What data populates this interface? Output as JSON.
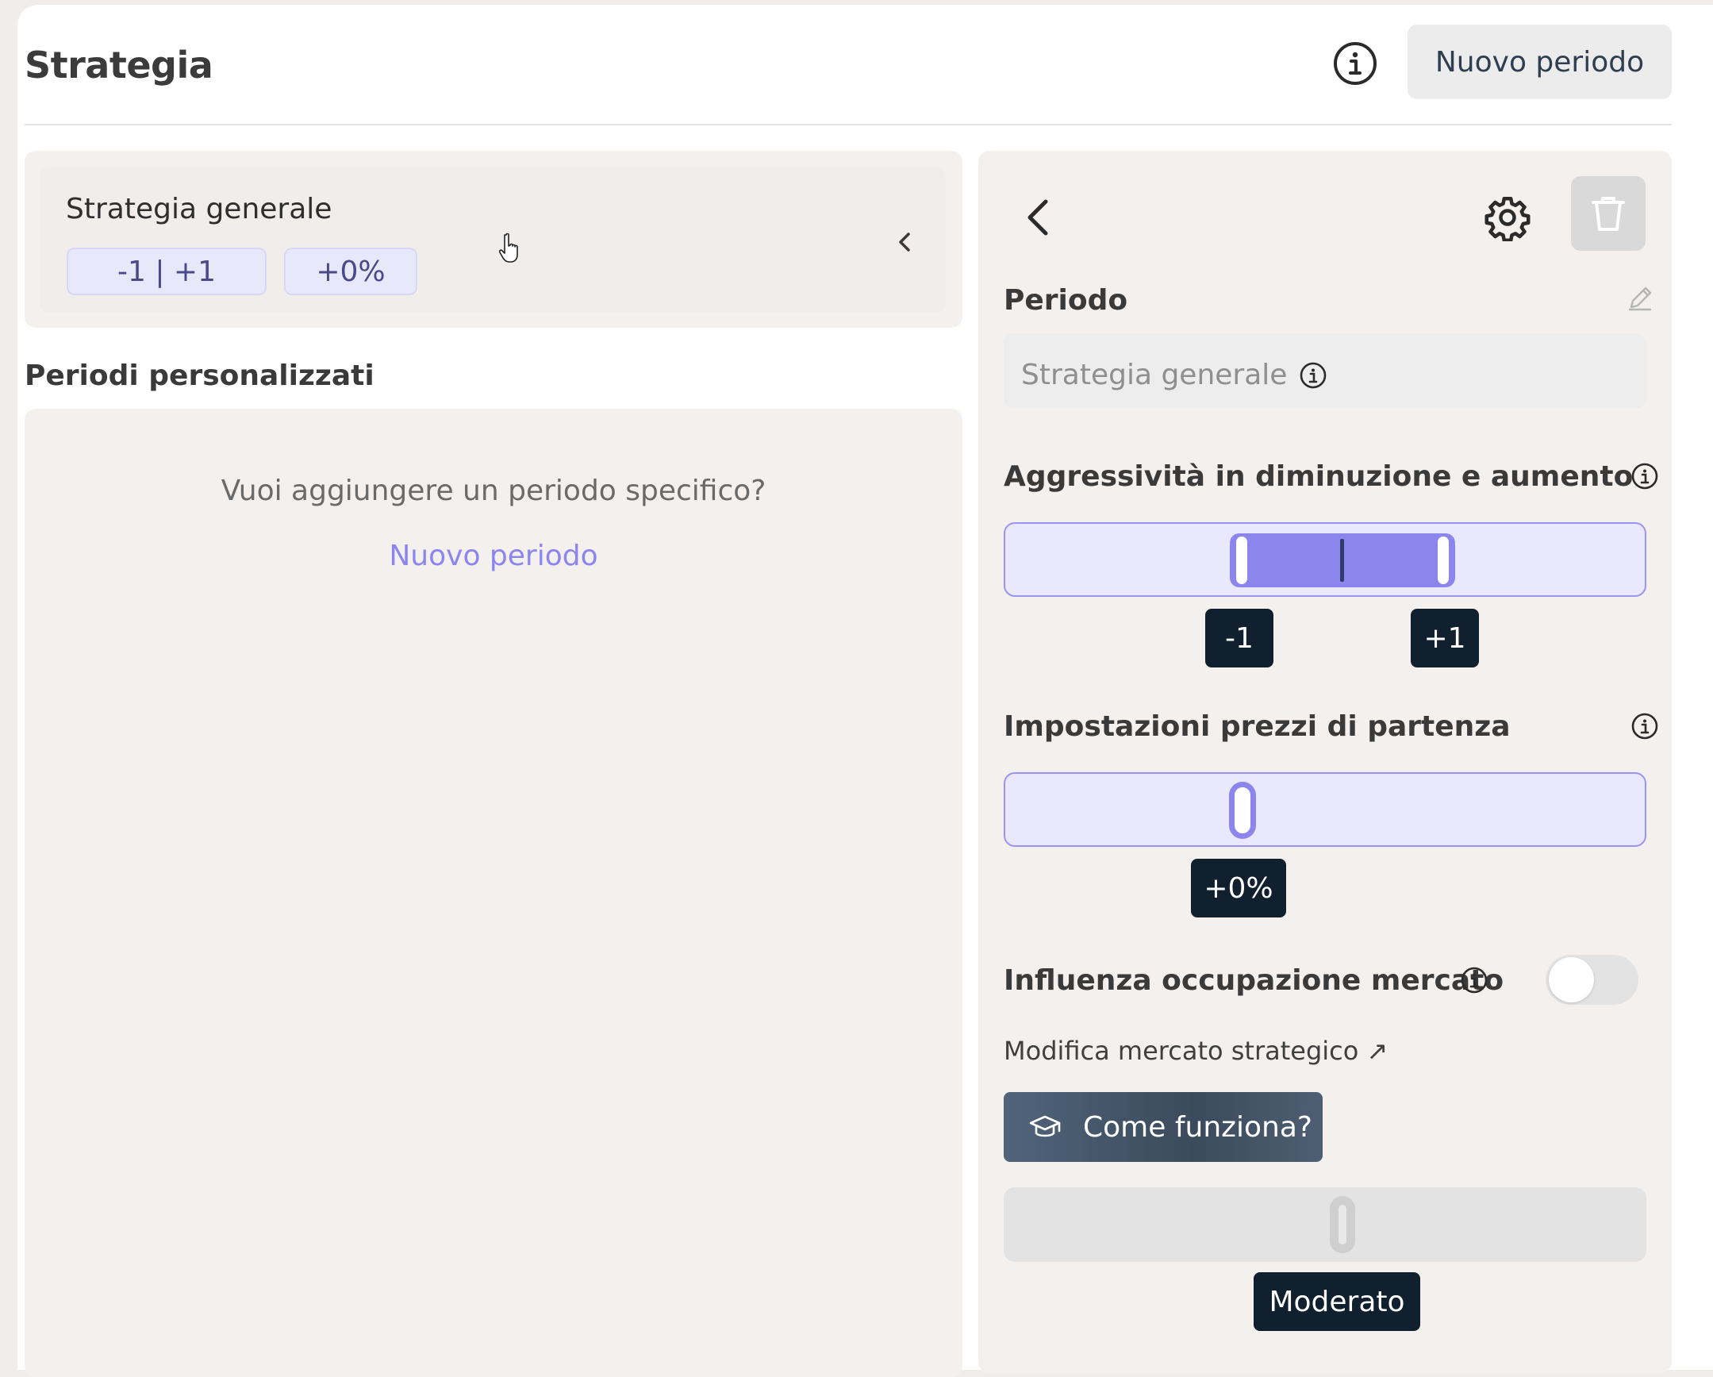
{
  "header": {
    "title": "Strategia",
    "new_period_button": "Nuovo periodo",
    "info_icon": "info-icon"
  },
  "general_strategy": {
    "title": "Strategia generale",
    "aggressiveness_chip": "-1 | +1",
    "price_chip": "+0%"
  },
  "custom_periods": {
    "title": "Periodi personalizzati",
    "empty_question": "Vuoi aggiungere un periodo specifico?",
    "add_link": "Nuovo periodo"
  },
  "detail": {
    "period_label": "Periodo",
    "period_value": "Strategia generale",
    "aggressiveness": {
      "label": "Aggressività in diminuzione e aumento",
      "min_tip": "-1",
      "max_tip": "+1",
      "range": [
        -1,
        1
      ]
    },
    "starting_prices": {
      "label": "Impostazioni prezzi di partenza",
      "value_tip": "+0%",
      "value": 0
    },
    "market_occupancy": {
      "label": "Influenza occupazione mercato",
      "enabled": false
    },
    "edit_market_link": "Modifica mercato strategico ↗",
    "how_it_works_button": "Come funziona?",
    "intensity_tip": "Moderato"
  },
  "colors": {
    "accent": "#8c85ee",
    "tooltip_bg": "#10202e",
    "link": "#8b86ef"
  }
}
